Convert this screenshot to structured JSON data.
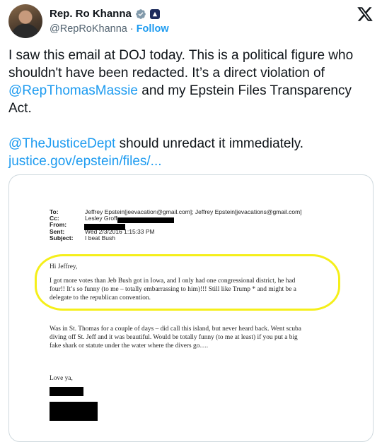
{
  "author": {
    "name": "Rep. Ro Khanna",
    "handle": "@RepRoKhanna",
    "separator": "·",
    "follow_label": "Follow"
  },
  "tweet": {
    "p1_text": "I saw this email at DOJ today. This is a political figure who shouldn't have been redacted. It’s a direct violation of ",
    "p1_mention": "@RepThomasMassie",
    "p1_tail": " and my Epstein Files Transparency Act.",
    "p2_mention": "@TheJusticeDept",
    "p2_text": " should unredact it immediately.",
    "link": "justice.gov/epstein/files/..."
  },
  "email": {
    "to_label": "To:",
    "to_value": "Jeffrey Epstein[jeevacation@gmail.com]; Jeffrey Epstein[jevacations@gmail.com]",
    "cc_label": "Cc:",
    "cc_value": "Lesley Groff",
    "from_label": "From:",
    "sent_label": "Sent:",
    "sent_value": "Wed 2/3/2016 1:15:33 PM",
    "subject_label": "Subject:",
    "subject_value": "I beat Bush",
    "greeting": "Hi Jeffrey,",
    "para1_l1": "I got more votes than Jeb Bush got in Iowa, and I only had one congressional district, he had",
    "para1_l2": "four!!  It’s so funny (to me – totally embarrassing to him)!!!  Still like Trump *  and might be a",
    "para1_l3": "delegate to the republican convention.",
    "para2_l1": "Was in St. Thomas for a couple of days – did call this island, but never heard back.  Went scuba",
    "para2_l2": "diving off St. Jeff and it was beautiful.  Would be totally funny (to me at least) if you put a big",
    "para2_l3": "fake shark or statute under the water where the divers go….",
    "closing": "Love ya,"
  },
  "colors": {
    "link_blue": "#1d9bf0",
    "highlight_yellow": "#f5ef1a",
    "redaction": "#000000"
  }
}
